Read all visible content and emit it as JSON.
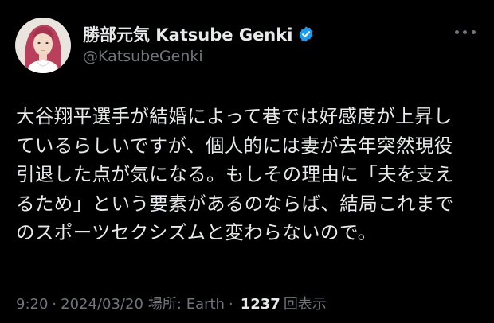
{
  "author": {
    "display_name": "勝部元気 Katsube Genki",
    "handle": "@KatsubeGenki",
    "verified": true,
    "verified_color": "#1d9bf0"
  },
  "tweet": {
    "lines": [
      "大谷翔平選手が結婚によって巷では好感度が上昇し",
      "ているらしいですが、個人的には妻が去年突然現役",
      "引退した点が気になる。もしその理由に「夫を支え",
      "るため」という要素があるのならば、結局これまで",
      "のスポーツセクシズムと変わらないので。"
    ]
  },
  "meta": {
    "time": "9:20",
    "separator": "·",
    "date": "2024/03/20",
    "location": "場所: Earth",
    "views_count": "1237",
    "views_label": "回表示"
  },
  "icons": {
    "more": "more-horizontal-icon",
    "verified": "verified-badge-icon"
  },
  "colors": {
    "background": "#000000",
    "text": "#e7e9ea",
    "secondary": "#71767b"
  }
}
